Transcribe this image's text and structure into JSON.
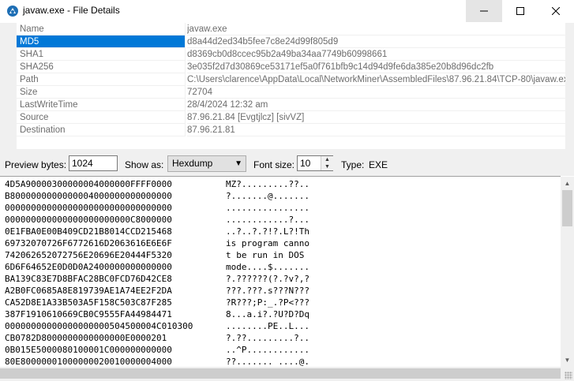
{
  "window": {
    "title": "javaw.exe - File Details",
    "icon": "app-icon"
  },
  "properties": [
    {
      "name": "Name",
      "value": "javaw.exe",
      "selected": false
    },
    {
      "name": "MD5",
      "value": "d8a44d2ed34b5fee7c8e24d99f805d9",
      "selected": true
    },
    {
      "name": "SHA1",
      "value": "d8369cb0d8ccec95b2a49ba34aa7749b60998661",
      "selected": false
    },
    {
      "name": "SHA256",
      "value": "3e035f2d7d30869ce53171ef5a0f761bfb9c14d94d9fe6da385e20b8d96dc2fb",
      "selected": false
    },
    {
      "name": "Path",
      "value": "C:\\Users\\clarence\\AppData\\Local\\NetworkMiner\\AssembledFiles\\87.96.21.84\\TCP-80\\javaw.exe",
      "selected": false
    },
    {
      "name": "Size",
      "value": "72704",
      "selected": false
    },
    {
      "name": "LastWriteTime",
      "value": "28/4/2024 12:32 am",
      "selected": false
    },
    {
      "name": "Source",
      "value": "87.96.21.84 [Evgtjlcz] [sivVZ]",
      "selected": false
    },
    {
      "name": "Destination",
      "value": "87.96.21.81",
      "selected": false
    }
  ],
  "toolbar": {
    "preview_bytes_label": "Preview bytes:",
    "preview_bytes_value": "1024",
    "show_as_label": "Show as:",
    "show_as_value": "Hexdump",
    "font_size_label": "Font size:",
    "font_size_value": "10",
    "type_label": "Type:",
    "type_value": "EXE"
  },
  "hexdump": [
    {
      "hex": "4D5A90000300000004000000FFFF0000",
      "ascii": "MZ?.........??.."
    },
    {
      "hex": "B8000000000000004000000000000000",
      "ascii": "?.......@......."
    },
    {
      "hex": "00000000000000000000000000000000",
      "ascii": "................"
    },
    {
      "hex": "000000000000000000000000C8000000",
      "ascii": "............?..."
    },
    {
      "hex": "0E1FBA0E00B409CD21B8014CCD215468",
      "ascii": "..?..?.?!?.L?!Th"
    },
    {
      "hex": "69732070726F6772616D2063616E6E6F",
      "ascii": "is program canno"
    },
    {
      "hex": "742062652072756E20696E20444F5320",
      "ascii": "t be run in DOS "
    },
    {
      "hex": "6D6F64652E0D0D0A2400000000000000",
      "ascii": "mode....$......."
    },
    {
      "hex": "BA139C83E7D8BFAC28BC0FCD76D42CE8",
      "ascii": "?.??????(?.?v?,?"
    },
    {
      "hex": "A2B0FC0685A8E819739AE1A74EE2F2DA",
      "ascii": "???.???.s???N???"
    },
    {
      "hex": "CA52D8E1A33B503A5F158C503C87F285",
      "ascii": "?R???;P:_.?P<???"
    },
    {
      "hex": "387F1910610669CB0C9555FA44984471",
      "ascii": "8...a.i?.?U?D?Dq"
    },
    {
      "hex": "00000000000000000000504500004C010300",
      "ascii": "........PE..L..."
    },
    {
      "hex": "CB0782D8000000000000000E0000201",
      "ascii": "?.??.........?.."
    },
    {
      "hex": "0B015E5000080100001C000000000000",
      "ascii": "..^P............"
    },
    {
      "hex": "80E80000001000000020010000004000",
      "ascii": "??....... ....@."
    }
  ]
}
